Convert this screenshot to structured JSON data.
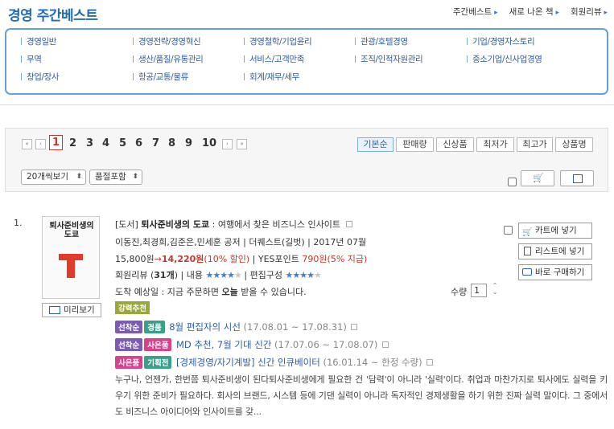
{
  "header": {
    "title": "경영 주간베스트",
    "links": [
      "주간베스트",
      "새로 나온 책",
      "회원리뷰"
    ]
  },
  "categories": {
    "col1": [
      "경영일반",
      "무역",
      "창업/장사"
    ],
    "col2": [
      "경영전략/경영혁신",
      "생산/품질/유통관리",
      "항공/교통/물류"
    ],
    "col3": [
      "경영철학/기업윤리",
      "서비스/고객만족",
      "회계/재무/세무"
    ],
    "col4": [
      "관광/호텔경영",
      "조직/인적자원관리"
    ],
    "col5": [
      "기업/경영자스토리",
      "중소기업/신사업경영"
    ]
  },
  "pagination": {
    "first": "«",
    "prev": "‹",
    "next": "›",
    "last": "»",
    "pages": [
      "1",
      "2",
      "3",
      "4",
      "5",
      "6",
      "7",
      "8",
      "9",
      "10"
    ],
    "current": "1"
  },
  "sort": {
    "options": [
      "기본순",
      "판매량",
      "신상품",
      "최저가",
      "최고가",
      "상품명"
    ],
    "selected": "기본순"
  },
  "controls": {
    "per_page": "20개씩보기",
    "stock": "품절포함"
  },
  "book": {
    "rank": "1.",
    "cover_title": "퇴사준비생의 도쿄",
    "preview": "미리보기",
    "category": "[도서]",
    "title": "퇴사준비생의 도쿄",
    "subtitle": " : 여행에서 찾은 비즈니스 인사이트",
    "authors": "이동진,최경희,김준은,민세훈 공저",
    "publisher": "더퀘스트(길벗)",
    "date": "2017년 07월",
    "price": "15,800원",
    "arrow": "→",
    "sale_price": "14,220원",
    "discount": "(10% 할인)",
    "points_label": "YES포인트",
    "points": "790원",
    "points_rate": "(5% 지급)",
    "review_label": "회원리뷰 (",
    "review_count": "31개",
    "review_close": ")",
    "content_label": "내용",
    "content_rating": 4,
    "layout_label": "편집구성",
    "layout_rating": 4,
    "delivery": "도착 예상일 : 지금 주문하면 ",
    "delivery_day": "오늘",
    "delivery_end": " 받을 수 있습니다.",
    "qty_label": "수량",
    "qty": "1",
    "badge": "강력추천",
    "promos": [
      {
        "tags": [
          "선착순",
          "경품"
        ],
        "text": "8월 편집자의 시선",
        "period": " (17.08.01 ~ 17.08.31)"
      },
      {
        "tags": [
          "선착순",
          "사은품"
        ],
        "text": "MD 추천, 7월 기대 신간",
        "period": " (17.07.06 ~ 17.08.07)"
      },
      {
        "tags": [
          "사은품",
          "기획전"
        ],
        "text": "[경제경영/자기계발] 신간 인큐베이터",
        "period": " (16.01.14 ~ 한정 수량)"
      }
    ],
    "description": "누구나, 언젠가, 한번쯤 퇴사준비생이 된다퇴사준비생에게 필요한 건 '담력'이 아니라 '실력'이다. 취업과 마찬가지로 퇴사에도 실력을 키우기 위한 준비가 필요하다. 회사의 브랜드, 시스템 등에 기댄 실력이 아니라 독자적인 경제생활을 하기 위한 진짜 실력 말이다. 그 중에서도 비즈니스 아이디어와 인사이트를 갖..."
  },
  "actions": {
    "cart": "카트에 넣기",
    "list": "리스트에 넣기",
    "buy": "바로 구매하기"
  },
  "colors": {
    "accent": "#1f6bb5",
    "price": "#c0392b",
    "tag_green": "#3aa08a",
    "tag_purple": "#7b5bb5",
    "tag_pink": "#d6438a",
    "tag_olive": "#9aa83a"
  }
}
